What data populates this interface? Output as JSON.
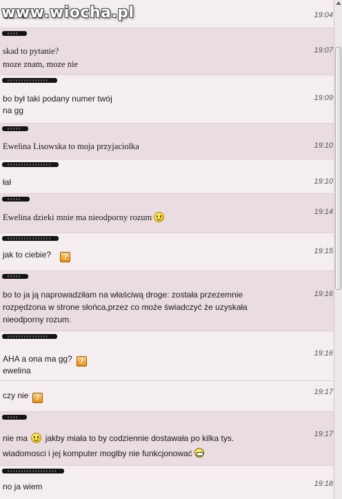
{
  "logo_text": "www.wiocha.pl",
  "messages": [
    {
      "time": "19:04",
      "lines": [
        "Cz... e ... a"
      ]
    },
    {
      "time": "19:07",
      "lines": [
        "skad to pytanie?",
        "moze znam, moze nie"
      ]
    },
    {
      "time": "19:09",
      "lines": [
        "bo był taki podany numer twój",
        "na gg"
      ]
    },
    {
      "time": "19:10",
      "lines": [
        "Ewelina Lisowska to moja przyjaciolka"
      ]
    },
    {
      "time": "19:10",
      "lines": [
        "łał"
      ]
    },
    {
      "time": "19:14",
      "lines": [
        "Ewelina dzieki mnie ma nieodporny rozum"
      ]
    },
    {
      "time": "19:15",
      "lines": [
        "jak to ciebie?"
      ]
    },
    {
      "time": "19:16",
      "lines": [
        "bo to ja ją naprowadziłam na właściwą droge: została przezemnie",
        "rozpędzona w strone słońca,przez co może świadczyć że uzyskała",
        "nieodporny rozum."
      ]
    },
    {
      "time": "19:16",
      "lines": [
        "AHA a ona ma gg?",
        "ewelina"
      ]
    },
    {
      "time": "19:17",
      "lines": [
        "czy nie"
      ]
    },
    {
      "time": "19:17",
      "lines": [
        "nie ma",
        "jakby miała to by codziennie dostawała po kilka tys.",
        "wiadomosci i jej komputer moglby nie funkcjonować"
      ]
    },
    {
      "time": "19:18",
      "lines": [
        "no ja wiem"
      ]
    }
  ],
  "icons": {
    "smile": "smile-emoticon-icon",
    "question": "question-emoticon-icon",
    "grin": "grin-emoticon-icon"
  },
  "colors": {
    "row_light": "#f5eef1",
    "row_dark": "#e9dde2"
  }
}
